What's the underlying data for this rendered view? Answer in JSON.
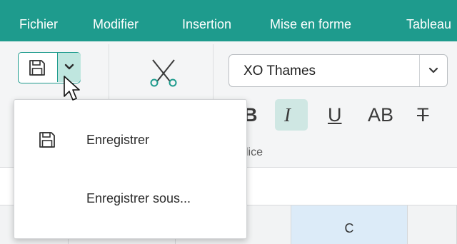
{
  "menubar": {
    "items": [
      "Fichier",
      "Modifier",
      "Insertion",
      "Mise en forme",
      "Tableau"
    ]
  },
  "ribbon": {
    "font_name": "XO Thames",
    "format_buttons": {
      "bold": "B",
      "italic": "I",
      "underline": "U",
      "caps": "AB",
      "strikethrough": "T"
    },
    "section_label": "lice"
  },
  "dropdown": {
    "items": [
      "Enregistrer",
      "Enregistrer sous..."
    ]
  },
  "sheet": {
    "column_selected": "C"
  },
  "colors": {
    "accent": "#1e9b8d",
    "accent_light": "#bfe6df",
    "column_selected_bg": "#dcebf8"
  }
}
